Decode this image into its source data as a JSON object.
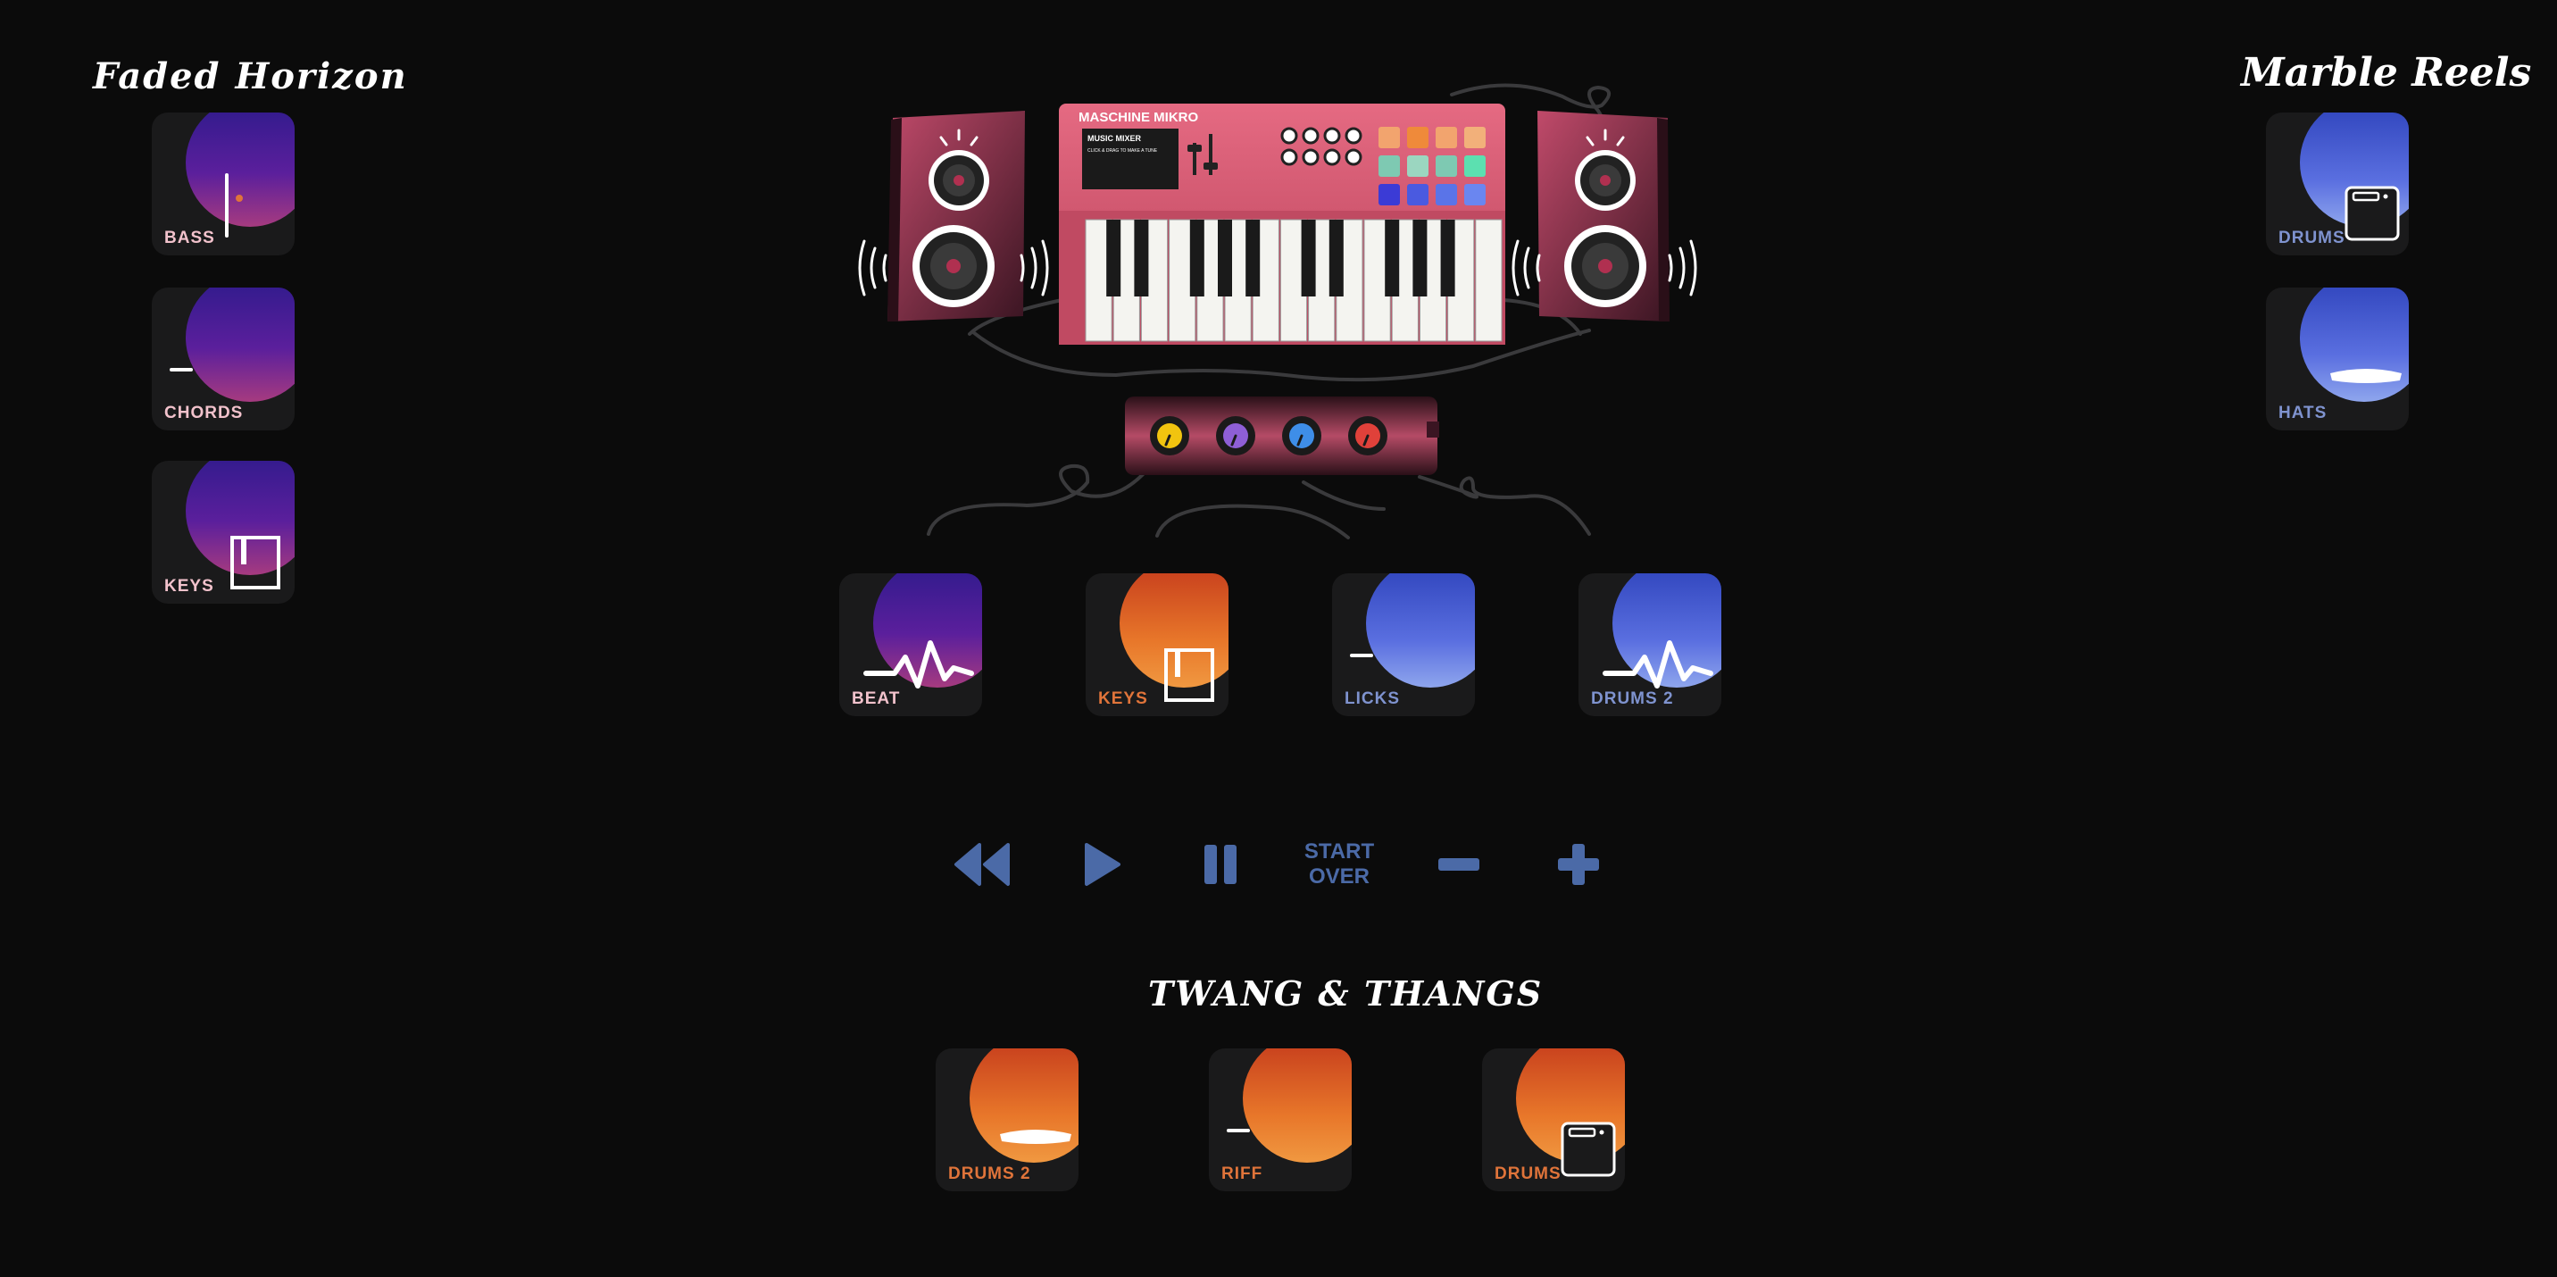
{
  "packs": {
    "faded_horizon": {
      "title": "Faded Horizon",
      "tiles": [
        {
          "label": "BASS",
          "icon": "mixer-sliders-icon"
        },
        {
          "label": "CHORDS",
          "icon": "speed-lines-icon"
        },
        {
          "label": "KEYS",
          "icon": "piano-keys-icon"
        }
      ]
    },
    "marble_reels": {
      "title": "Marble Reels",
      "tiles": [
        {
          "label": "DRUMS",
          "icon": "drum-machine-icon"
        },
        {
          "label": "HATS",
          "icon": "cymbal-icon"
        }
      ]
    },
    "twang_thangs": {
      "title": "TWANG & THANGS",
      "tiles": [
        {
          "label": "DRUMS 2",
          "icon": "cymbal-icon"
        },
        {
          "label": "RIFF",
          "icon": "speed-lines-icon"
        },
        {
          "label": "DRUMS",
          "icon": "drum-machine-icon"
        }
      ]
    }
  },
  "mixer_slots": [
    {
      "label": "BEAT",
      "theme": "faded-horizon",
      "icon": "waveform-icon"
    },
    {
      "label": "KEYS",
      "theme": "twang-thangs",
      "icon": "piano-keys-icon"
    },
    {
      "label": "LICKS",
      "theme": "marble-reels",
      "icon": "speed-lines-icon"
    },
    {
      "label": "DRUMS 2",
      "theme": "marble-reels",
      "icon": "waveform-icon"
    }
  ],
  "keyboard": {
    "brand": "MASCHINE MIKRO",
    "screen_title": "MUSIC MIXER",
    "screen_subtitle": "CLICK & DRAG TO MAKE A TUNE"
  },
  "knob_colors": [
    "#f1c40f",
    "#8e5fd6",
    "#3e8ee8",
    "#e0413a"
  ],
  "controls": {
    "rewind": "rewind-icon",
    "play": "play-icon",
    "pause": "pause-icon",
    "start_over": "START\nOVER",
    "minus": "minus-icon",
    "plus": "plus-icon"
  },
  "colors": {
    "background": "#0b0b0b",
    "tile_bg": "#1a1a1b",
    "control_blue": "#4b6aa7",
    "faded_horizon_label": "#f2c2cc",
    "twang_label": "#e0743a",
    "marble_label": "#7f93cf"
  }
}
